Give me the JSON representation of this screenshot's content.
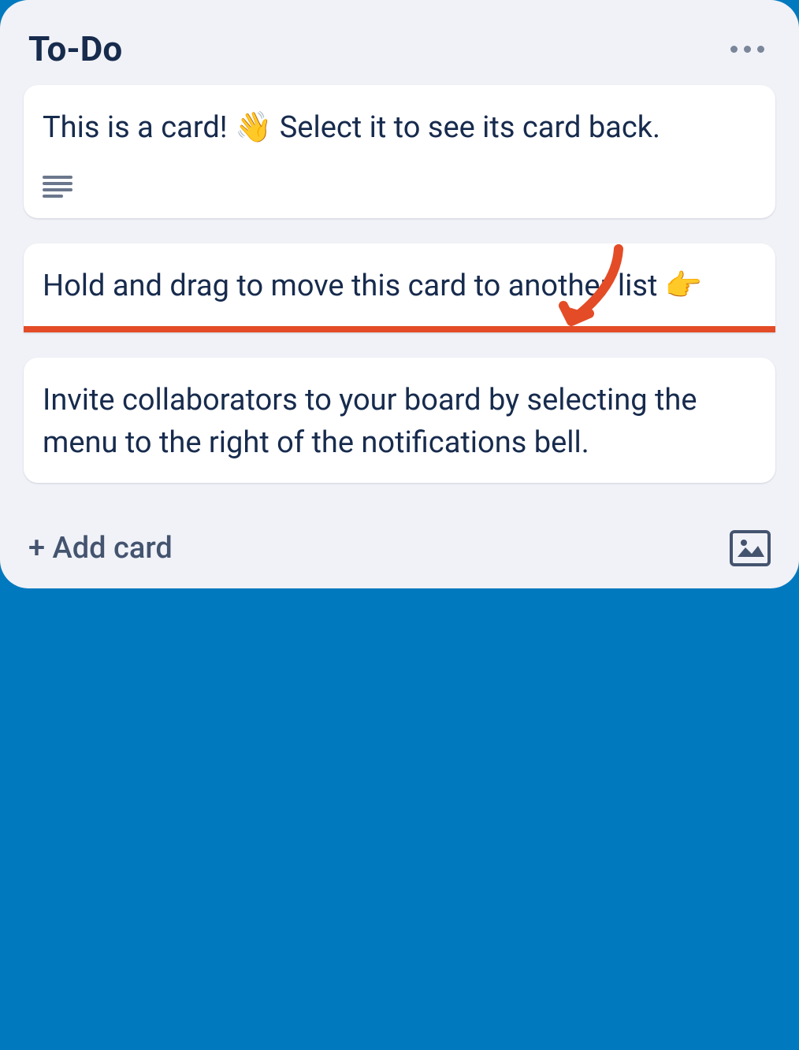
{
  "list": {
    "title": "To-Do",
    "cards": [
      {
        "text": "This is a card! 👋 Select it to see its card back.",
        "has_description": true
      },
      {
        "text": "Hold and drag to move this card to another list 👉",
        "highlighted": true
      },
      {
        "text": "Invite collaborators to your board by selecting the menu to the right of the notifications bell."
      }
    ],
    "add_card_label": "+ Add card"
  },
  "colors": {
    "background": "#0079bf",
    "list_bg": "#f1f2f7",
    "card_bg": "#ffffff",
    "text_primary": "#172b4d",
    "text_secondary": "#44546f",
    "highlight": "#e34c26"
  }
}
